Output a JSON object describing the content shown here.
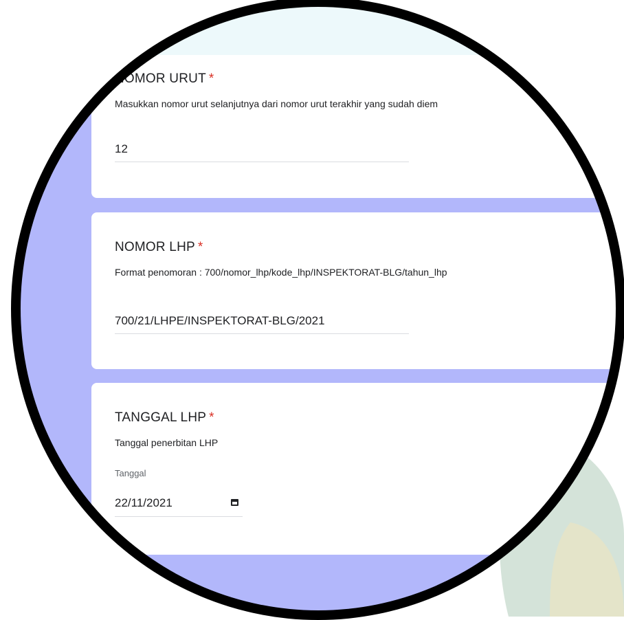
{
  "form": {
    "required_mark": "*",
    "questions": [
      {
        "title": "NOMOR URUT",
        "description": "Masukkan nomor urut selanjutnya dari nomor urut terakhir yang sudah diem",
        "value": "12"
      },
      {
        "title": "NOMOR LHP",
        "description": "Format penomoran : 700/nomor_lhp/kode_lhp/INSPEKTORAT-BLG/tahun_lhp",
        "value": "700/21/LHPE/INSPEKTORAT-BLG/2021"
      },
      {
        "title": "TANGGAL LHP",
        "description": "Tanggal penerbitan LHP",
        "date_label": "Tanggal",
        "value": "22/11/2021"
      }
    ]
  },
  "colors": {
    "background": "#b2b7fb",
    "card": "#ffffff",
    "required": "#d93025",
    "lens_ring": "#000000"
  },
  "icons": {
    "date": "calendar-icon"
  }
}
